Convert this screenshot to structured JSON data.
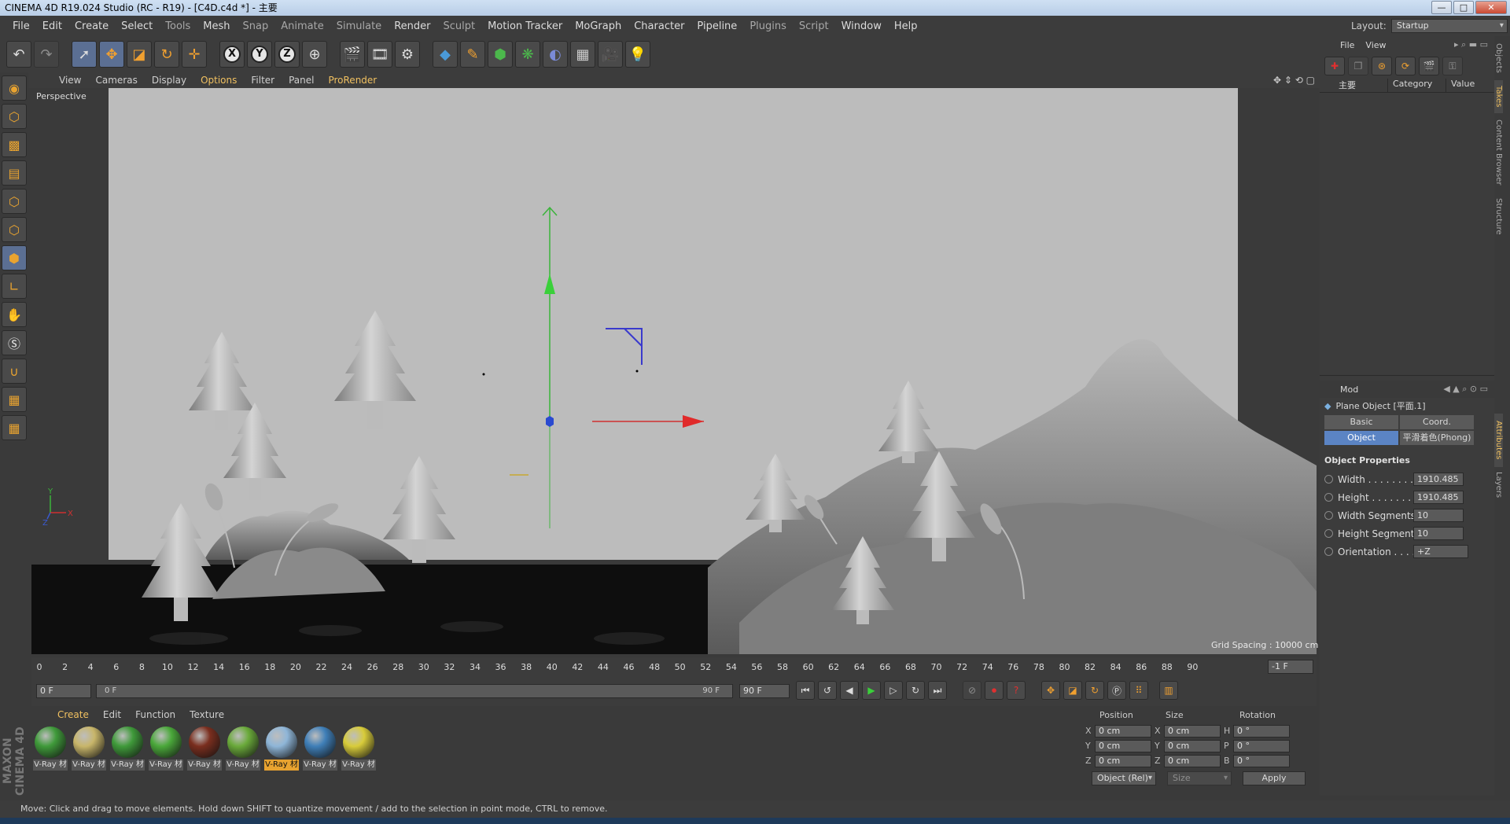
{
  "window": {
    "title": "CINEMA 4D R19.024 Studio (RC - R19) - [C4D.c4d *] - 主要",
    "min": "—",
    "max": "□",
    "close": "✕"
  },
  "menu": [
    "File",
    "Edit",
    "Create",
    "Select",
    "Tools",
    "Mesh",
    "Snap",
    "Animate",
    "Simulate",
    "Render",
    "Sculpt",
    "Motion Tracker",
    "MoGraph",
    "Character",
    "Pipeline",
    "Plugins",
    "Script",
    "Window",
    "Help"
  ],
  "layout": {
    "label": "Layout:",
    "value": "Startup"
  },
  "toolbar": {
    "x": "X",
    "y": "Y",
    "z": "Z"
  },
  "viewport": {
    "menu": [
      "View",
      "Cameras",
      "Display",
      "Options",
      "Filter",
      "Panel",
      "ProRender"
    ],
    "label": "Perspective",
    "grid_spacing": "Grid Spacing : 10000 cm"
  },
  "timeline": {
    "ticks": [
      "0",
      "2",
      "4",
      "6",
      "8",
      "10",
      "12",
      "14",
      "16",
      "18",
      "20",
      "22",
      "24",
      "26",
      "28",
      "30",
      "32",
      "34",
      "36",
      "38",
      "40",
      "42",
      "44",
      "46",
      "48",
      "50",
      "52",
      "54",
      "56",
      "58",
      "60",
      "62",
      "64",
      "66",
      "68",
      "70",
      "72",
      "74",
      "76",
      "78",
      "80",
      "82",
      "84",
      "86",
      "88",
      "90"
    ],
    "current": "-1 F",
    "start": "0 F",
    "range_start": "0 F",
    "range_end": "90 F",
    "end": "90 F"
  },
  "materials": {
    "menu": [
      "Create",
      "Edit",
      "Function",
      "Texture"
    ],
    "items": [
      {
        "name": "V-Ray 材",
        "color": "#3f9a3a"
      },
      {
        "name": "V-Ray 材",
        "color": "#c8b66a"
      },
      {
        "name": "V-Ray 材",
        "color": "#3f9a3a"
      },
      {
        "name": "V-Ray 材",
        "color": "#4aa83a"
      },
      {
        "name": "V-Ray 材",
        "color": "#7a2e1e"
      },
      {
        "name": "V-Ray 材",
        "color": "#6aaa3a"
      },
      {
        "name": "V-Ray 材",
        "color": "#8fb6d8"
      },
      {
        "name": "V-Ray 材",
        "color": "#3f7fb8"
      },
      {
        "name": "V-Ray 材",
        "color": "#d8cc3a"
      }
    ]
  },
  "coords": {
    "headers": [
      "Position",
      "Size",
      "Rotation"
    ],
    "rows": [
      {
        "a": "X",
        "pos": "0 cm",
        "b": "X",
        "size": "0 cm",
        "c": "H",
        "rot": "0 °"
      },
      {
        "a": "Y",
        "pos": "0 cm",
        "b": "Y",
        "size": "0 cm",
        "c": "P",
        "rot": "0 °"
      },
      {
        "a": "Z",
        "pos": "0 cm",
        "b": "Z",
        "size": "0 cm",
        "c": "B",
        "rot": "0 °"
      }
    ],
    "mode": "Object (Rel)",
    "size_mode": "Size",
    "apply": "Apply"
  },
  "objects_panel": {
    "menu": [
      "File",
      "View"
    ],
    "tree_item": "主要",
    "col_category": "Category",
    "col_value": "Value"
  },
  "attributes": {
    "menu": "Mod",
    "object_title": "Plane Object [平面.1]",
    "tabs": [
      "Basic",
      "Coord.",
      "Object",
      "平滑着色(Phong)"
    ],
    "section": "Object Properties",
    "props": [
      {
        "label": "Width . . . . . . . . . .",
        "value": "1910.485"
      },
      {
        "label": "Height . . . . . . . . . .",
        "value": "1910.485"
      },
      {
        "label": "Width Segments",
        "value": "10"
      },
      {
        "label": "Height Segments",
        "value": "10"
      },
      {
        "label": "Orientation . . . . .",
        "value": "+Z"
      }
    ]
  },
  "sidetabs": [
    "Objects",
    "Takes",
    "Content Browser",
    "Structure",
    "Attributes",
    "Layers"
  ],
  "status": "Move: Click and drag to move elements. Hold down SHIFT to quantize movement / add to the selection in point mode, CTRL to remove.",
  "brand": "MAXON CINEMA 4D"
}
